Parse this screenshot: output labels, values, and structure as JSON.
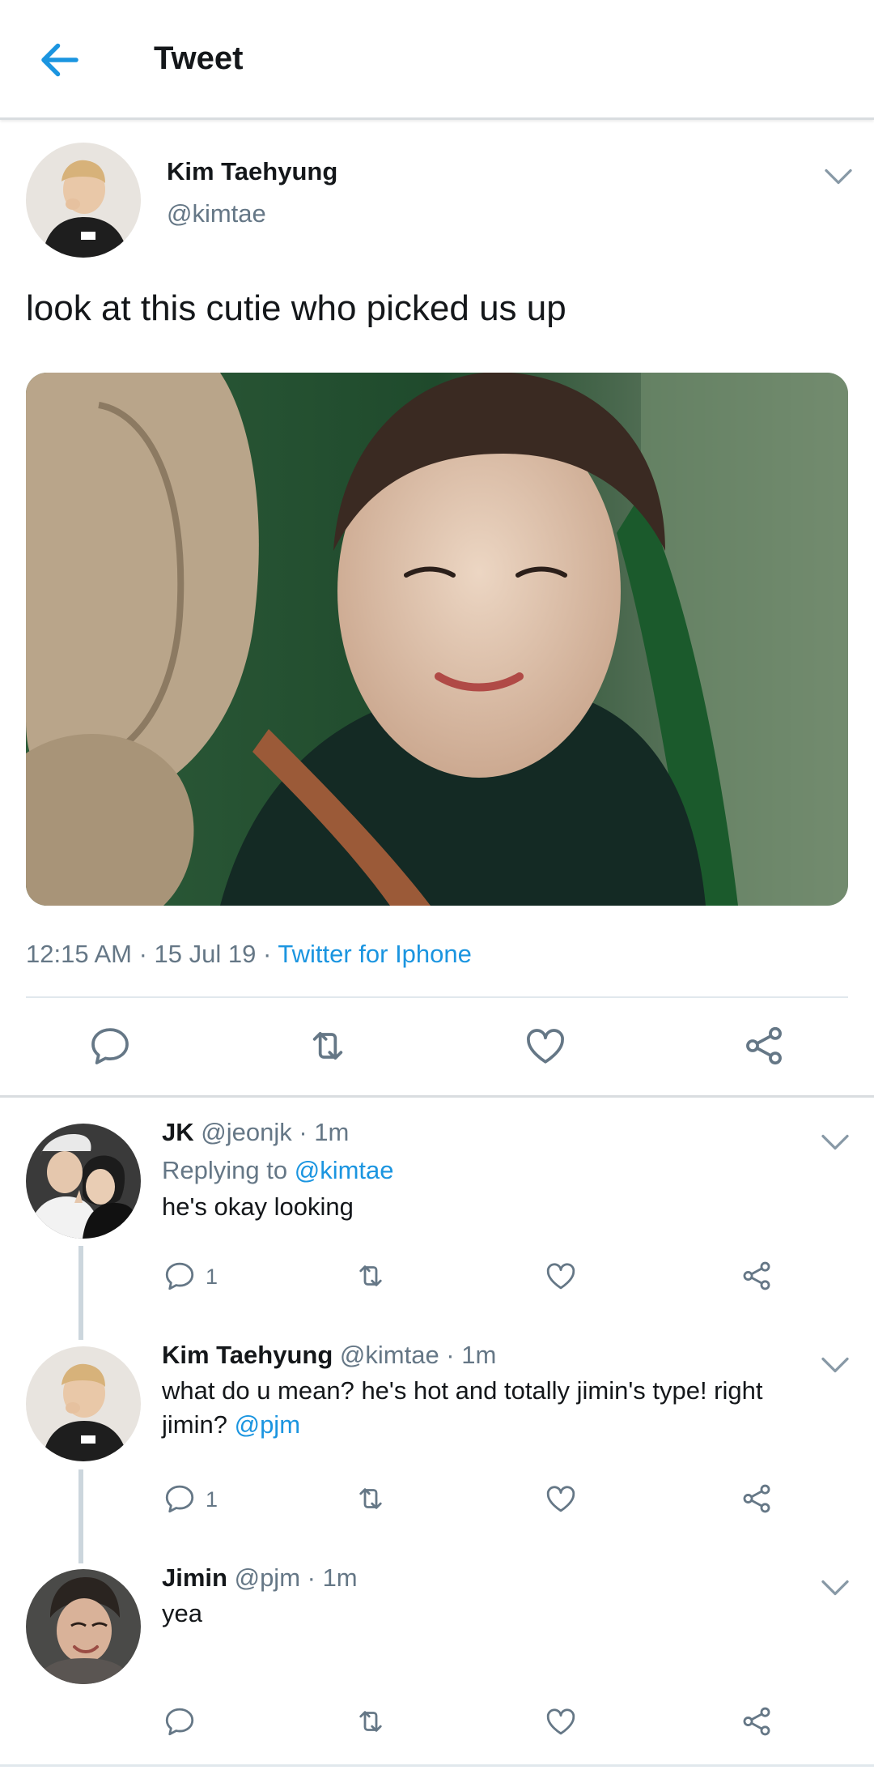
{
  "header": {
    "title": "Tweet",
    "back_icon": "arrow-left-icon"
  },
  "colors": {
    "accent": "#1b95e0",
    "secondary_text": "#657786",
    "divider": "#e1e8ed"
  },
  "tweet": {
    "name": "Kim Taehyung",
    "handle": "@kimtae",
    "text": "look at this cutie who picked us up",
    "time": "12:15 AM",
    "date": "15 Jul 19",
    "source": "Twitter for Iphone",
    "separator": " · ",
    "actions": [
      "reply-icon",
      "retweet-icon",
      "like-icon",
      "share-icon"
    ]
  },
  "replies": [
    {
      "name": "JK",
      "handle_time": "@jeonjk · 1m",
      "replying_prefix": "Replying to ",
      "replying_to": "@kimtae",
      "text": "he's okay looking",
      "reply_count": "1"
    },
    {
      "name": "Kim Taehyung",
      "handle_time": "@kimtae · 1m",
      "text_line1": "what do u mean? he's hot and totally jimin's type! right",
      "text_line2": "jimin? ",
      "mention": "@pjm",
      "reply_count": "1"
    },
    {
      "name": "Jimin",
      "handle_time": "@pjm · 1m",
      "text": "yea",
      "reply_count": ""
    }
  ]
}
